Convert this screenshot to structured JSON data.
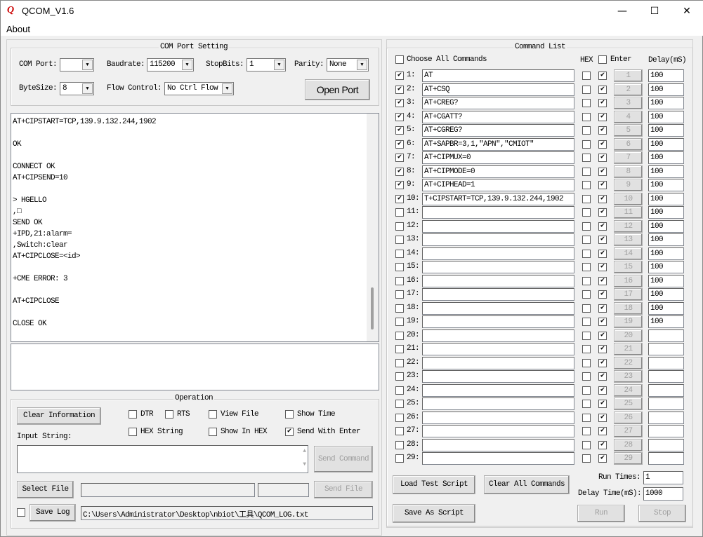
{
  "window": {
    "title": "QCOM_V1.6",
    "minimize": "—",
    "maximize": "☐",
    "close": "✕",
    "app_icon": "q-logo-icon"
  },
  "menu": {
    "about": "About"
  },
  "com_port_setting": {
    "title": "COM Port Setting",
    "com_port_label": "COM Port:",
    "com_port_value": "",
    "baudrate_label": "Baudrate:",
    "baudrate_value": "115200",
    "stopbits_label": "StopBits:",
    "stopbits_value": "1",
    "parity_label": "Parity:",
    "parity_value": "None",
    "bytesize_label": "ByteSize:",
    "bytesize_value": "8",
    "flow_control_label": "Flow Control:",
    "flow_control_value": "No Ctrl Flow",
    "open_port": "Open Port"
  },
  "log": {
    "text": "AT+CIPSTART=TCP,139.9.132.244,1902\n\nOK\n\nCONNECT OK\nAT+CIPSEND=10\n\n> HGELLO\n,□\nSEND OK\n+IPD,21:alarm=\n,Switch:clear\nAT+CIPCLOSE=<id>\n\n+CME ERROR: 3\n\nAT+CIPCLOSE\n\nCLOSE OK",
    "scroll_position": 0.95
  },
  "operation": {
    "title": "Operation",
    "clear_information": "Clear Information",
    "dtr": "DTR",
    "dtr_checked": false,
    "rts": "RTS",
    "rts_checked": false,
    "view_file": "View File",
    "view_file_checked": false,
    "show_time": "Show Time",
    "show_time_checked": false,
    "hex_string": "HEX String",
    "hex_string_checked": false,
    "show_in_hex": "Show In HEX",
    "show_in_hex_checked": false,
    "send_with_enter": "Send With Enter",
    "send_with_enter_checked": true,
    "input_string_label": "Input String:",
    "input_value": "",
    "send_command": "Send Command",
    "select_file": "Select File",
    "file_path": "",
    "file_info": "",
    "send_file": "Send File",
    "save_log_checked": false,
    "save_log": "Save Log",
    "log_path": "C:\\Users\\Administrator\\Desktop\\nbiot\\工具\\QCOM_LOG.txt"
  },
  "command_list": {
    "title": "Command List",
    "choose_all": "Choose All Commands",
    "hex_header": "HEX",
    "enter_header": "Enter",
    "delay_header": "Delay(mS)",
    "commands": [
      {
        "n": "1:",
        "cmd": "AT",
        "checked": true,
        "hex": false,
        "enter": true,
        "btn": "1",
        "delay": "100"
      },
      {
        "n": "2:",
        "cmd": "AT+CSQ",
        "checked": true,
        "hex": false,
        "enter": true,
        "btn": "2",
        "delay": "100"
      },
      {
        "n": "3:",
        "cmd": "AT+CREG?",
        "checked": true,
        "hex": false,
        "enter": true,
        "btn": "3",
        "delay": "100"
      },
      {
        "n": "4:",
        "cmd": "AT+CGATT?",
        "checked": true,
        "hex": false,
        "enter": true,
        "btn": "4",
        "delay": "100"
      },
      {
        "n": "5:",
        "cmd": "AT+CGREG?",
        "checked": true,
        "hex": false,
        "enter": true,
        "btn": "5",
        "delay": "100"
      },
      {
        "n": "6:",
        "cmd": "AT+SAPBR=3,1,\"APN\",\"CMIOT\"",
        "checked": true,
        "hex": false,
        "enter": true,
        "btn": "6",
        "delay": "100"
      },
      {
        "n": "7:",
        "cmd": "AT+CIPMUX=0",
        "checked": true,
        "hex": false,
        "enter": true,
        "btn": "7",
        "delay": "100"
      },
      {
        "n": "8:",
        "cmd": "AT+CIPMODE=0",
        "checked": true,
        "hex": false,
        "enter": true,
        "btn": "8",
        "delay": "100"
      },
      {
        "n": "9:",
        "cmd": "AT+CIPHEAD=1",
        "checked": true,
        "hex": false,
        "enter": true,
        "btn": "9",
        "delay": "100"
      },
      {
        "n": "10:",
        "cmd": "T+CIPSTART=TCP,139.9.132.244,1902",
        "checked": true,
        "hex": false,
        "enter": true,
        "btn": "10",
        "delay": "100"
      },
      {
        "n": "11:",
        "cmd": "",
        "checked": false,
        "hex": false,
        "enter": true,
        "btn": "11",
        "delay": "100"
      },
      {
        "n": "12:",
        "cmd": "",
        "checked": false,
        "hex": false,
        "enter": true,
        "btn": "12",
        "delay": "100"
      },
      {
        "n": "13:",
        "cmd": "",
        "checked": false,
        "hex": false,
        "enter": true,
        "btn": "13",
        "delay": "100"
      },
      {
        "n": "14:",
        "cmd": "",
        "checked": false,
        "hex": false,
        "enter": true,
        "btn": "14",
        "delay": "100"
      },
      {
        "n": "15:",
        "cmd": "",
        "checked": false,
        "hex": false,
        "enter": true,
        "btn": "15",
        "delay": "100"
      },
      {
        "n": "16:",
        "cmd": "",
        "checked": false,
        "hex": false,
        "enter": true,
        "btn": "16",
        "delay": "100"
      },
      {
        "n": "17:",
        "cmd": "",
        "checked": false,
        "hex": false,
        "enter": true,
        "btn": "17",
        "delay": "100"
      },
      {
        "n": "18:",
        "cmd": "",
        "checked": false,
        "hex": false,
        "enter": true,
        "btn": "18",
        "delay": "100"
      },
      {
        "n": "19:",
        "cmd": "",
        "checked": false,
        "hex": false,
        "enter": true,
        "btn": "19",
        "delay": "100"
      },
      {
        "n": "20:",
        "cmd": "",
        "checked": false,
        "hex": false,
        "enter": true,
        "btn": "20",
        "delay": ""
      },
      {
        "n": "21:",
        "cmd": "",
        "checked": false,
        "hex": false,
        "enter": true,
        "btn": "21",
        "delay": ""
      },
      {
        "n": "22:",
        "cmd": "",
        "checked": false,
        "hex": false,
        "enter": true,
        "btn": "22",
        "delay": ""
      },
      {
        "n": "23:",
        "cmd": "",
        "checked": false,
        "hex": false,
        "enter": true,
        "btn": "23",
        "delay": ""
      },
      {
        "n": "24:",
        "cmd": "",
        "checked": false,
        "hex": false,
        "enter": true,
        "btn": "24",
        "delay": ""
      },
      {
        "n": "25:",
        "cmd": "",
        "checked": false,
        "hex": false,
        "enter": true,
        "btn": "25",
        "delay": ""
      },
      {
        "n": "26:",
        "cmd": "",
        "checked": false,
        "hex": false,
        "enter": true,
        "btn": "26",
        "delay": ""
      },
      {
        "n": "27:",
        "cmd": "",
        "checked": false,
        "hex": false,
        "enter": true,
        "btn": "27",
        "delay": ""
      },
      {
        "n": "28:",
        "cmd": "",
        "checked": false,
        "hex": false,
        "enter": true,
        "btn": "28",
        "delay": ""
      },
      {
        "n": "29:",
        "cmd": "",
        "checked": false,
        "hex": false,
        "enter": true,
        "btn": "29",
        "delay": ""
      }
    ],
    "load_test_script": "Load Test Script",
    "clear_all_commands": "Clear All Commands",
    "save_as_script": "Save As Script",
    "run_times_label": "Run Times:",
    "run_times_value": "1",
    "delay_time_label": "Delay Time(mS):",
    "delay_time_value": "1000",
    "run": "Run",
    "stop": "Stop"
  }
}
